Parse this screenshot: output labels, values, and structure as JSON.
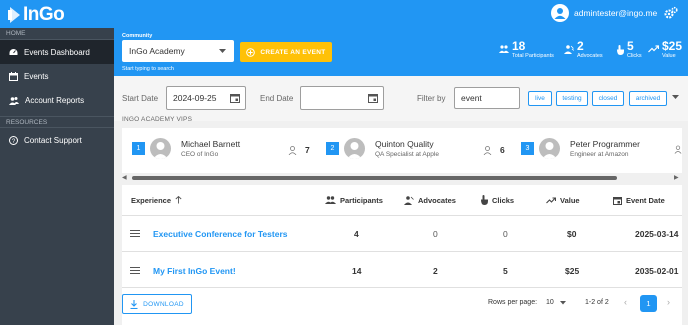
{
  "app": {
    "logo_text": "InGo",
    "user_email": "admintester@ingo.me"
  },
  "sidebar": {
    "home_header": "HOME",
    "resources_header": "RESOURCES",
    "items": [
      {
        "label": "Events Dashboard",
        "icon": "dashboard-icon",
        "active": true
      },
      {
        "label": "Events",
        "icon": "calendar-icon",
        "active": false
      },
      {
        "label": "Account Reports",
        "icon": "people-icon",
        "active": false
      }
    ],
    "resource_items": [
      {
        "label": "Contact Support",
        "icon": "help-circle-icon"
      }
    ]
  },
  "community": {
    "label": "Community",
    "selected": "InGo Academy",
    "hint": "Start typing to search",
    "create_button": "CREATE AN EVENT"
  },
  "stats": [
    {
      "value": "18",
      "label": "Total Participants",
      "icon": "people-icon"
    },
    {
      "value": "2",
      "label": "Advocates",
      "icon": "advocate-icon"
    },
    {
      "value": "5",
      "label": "Clicks",
      "icon": "touch-icon"
    },
    {
      "value": "$25",
      "label": "Value",
      "icon": "trending-up-icon"
    }
  ],
  "filters": {
    "start_label": "Start Date",
    "start_value": "2024-09-25",
    "end_label": "End Date",
    "end_value": "",
    "filter_label": "Filter by",
    "filter_value": "event",
    "chips": [
      "live",
      "testing",
      "closed",
      "archived"
    ]
  },
  "vips": {
    "title": "INGO ACADEMY VIPS",
    "items": [
      {
        "rank": "1",
        "name": "Michael Barnett",
        "role": "CEO of InGo",
        "count": "7"
      },
      {
        "rank": "2",
        "name": "Quinton Quality",
        "role": "QA Specialist at Apple",
        "count": "6"
      },
      {
        "rank": "3",
        "name": "Peter Programmer",
        "role": "Engineer at Amazon",
        "count": ""
      }
    ]
  },
  "table": {
    "headers": {
      "experience": "Experience",
      "participants": "Participants",
      "advocates": "Advocates",
      "clicks": "Clicks",
      "value": "Value",
      "event_date": "Event Date"
    },
    "rows": [
      {
        "experience": "Executive Conference for Testers",
        "participants": "4",
        "advocates": "0",
        "clicks": "0",
        "value": "$0",
        "event_date": "2025-03-14"
      },
      {
        "experience": "My First InGo Event!",
        "participants": "14",
        "advocates": "2",
        "clicks": "5",
        "value": "$25",
        "event_date": "2035-02-01"
      }
    ],
    "download_label": "DOWNLOAD",
    "rows_per_page_label": "Rows per page:",
    "rows_per_page_value": "10",
    "range": "1-2 of 2",
    "current_page": "1"
  }
}
